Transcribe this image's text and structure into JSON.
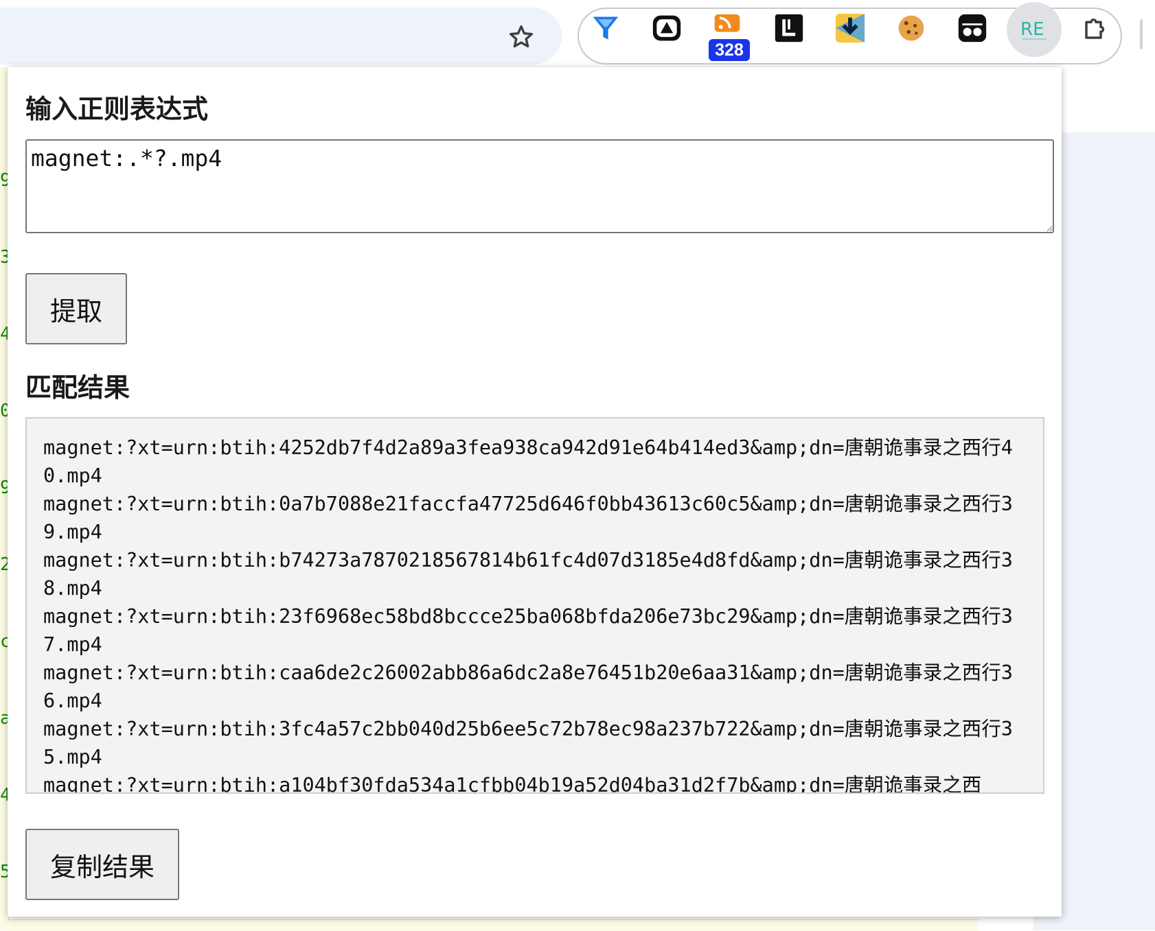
{
  "browser": {
    "extensions": [
      {
        "name": "funnel-icon",
        "color": "#1e78e8"
      },
      {
        "name": "triangle-app-icon"
      },
      {
        "name": "rss-reader-icon",
        "badge": "328",
        "badge_color": "#1a36e8"
      },
      {
        "name": "l-square-icon"
      },
      {
        "name": "download-arrow-icon"
      },
      {
        "name": "cookie-icon"
      },
      {
        "name": "incognito-glasses-icon"
      },
      {
        "name": "regex-extension-icon",
        "label": "RE",
        "active": true
      },
      {
        "name": "puzzle-extensions-icon"
      }
    ]
  },
  "background_page": {
    "left_fragments": [
      "9",
      "3",
      "4",
      "0",
      "9",
      "2",
      "c",
      "a",
      "4",
      "5"
    ]
  },
  "popup": {
    "regex_heading": "输入正则表达式",
    "regex_value": "magnet:.*?.mp4",
    "extract_button": "提取",
    "results_heading": "匹配结果",
    "results": [
      "magnet:?xt=urn:btih:4252db7f4d2a89a3fea938ca942d91e64b414ed3&amp;dn=唐朝诡事录之西行40.mp4",
      "magnet:?xt=urn:btih:0a7b7088e21faccfa47725d646f0bb43613c60c5&amp;dn=唐朝诡事录之西行39.mp4",
      "magnet:?xt=urn:btih:b74273a7870218567814b61fc4d07d3185e4d8fd&amp;dn=唐朝诡事录之西行38.mp4",
      "magnet:?xt=urn:btih:23f6968ec58bd8bccce25ba068bfda206e73bc29&amp;dn=唐朝诡事录之西行37.mp4",
      "magnet:?xt=urn:btih:caa6de2c26002abb86a6dc2a8e76451b20e6aa31&amp;dn=唐朝诡事录之西行36.mp4",
      "magnet:?xt=urn:btih:3fc4a57c2bb040d25b6ee5c72b78ec98a237b722&amp;dn=唐朝诡事录之西行35.mp4",
      "magnet:?xt=urn:btih:a104bf30fda534a1cfbb04b19a52d04ba31d2f7b&amp;dn=唐朝诡事录之西"
    ],
    "copy_button": "复制结果"
  }
}
